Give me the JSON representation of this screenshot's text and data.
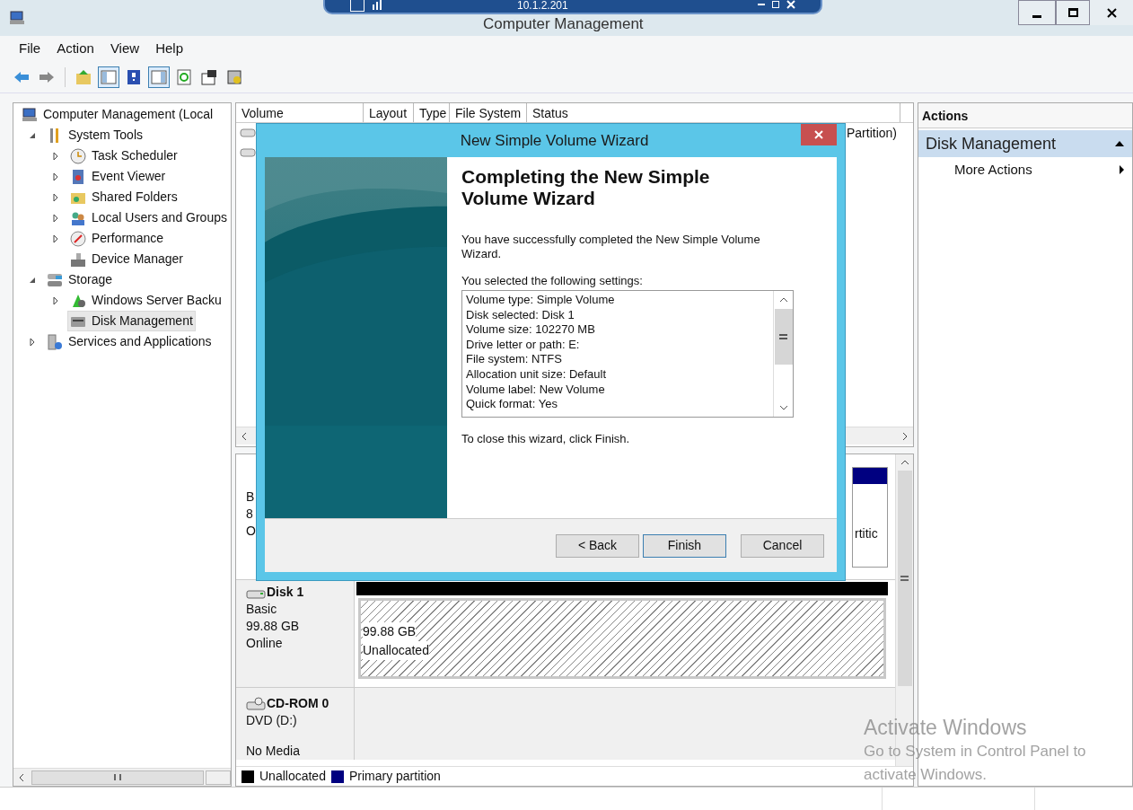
{
  "remote_bar": {
    "address": "10.1.2.201"
  },
  "window": {
    "title": "Computer Management"
  },
  "menu": [
    "File",
    "Action",
    "View",
    "Help"
  ],
  "toolbar": [
    {
      "kind": "back",
      "selected": false
    },
    {
      "kind": "forward",
      "selected": false
    },
    {
      "kind": "up",
      "selected": false
    },
    {
      "kind": "tree",
      "selected": true
    },
    {
      "kind": "help",
      "selected": false
    },
    {
      "kind": "actionpane",
      "selected": true
    },
    {
      "kind": "refresh",
      "selected": false
    },
    {
      "kind": "properties",
      "selected": false
    },
    {
      "kind": "export",
      "selected": false
    }
  ],
  "tree": [
    {
      "label": "Computer Management (Local",
      "kind": "computer",
      "selected": false,
      "children": [
        {
          "label": "System Tools",
          "kind": "tools",
          "expanded": true,
          "selected": false,
          "children": [
            {
              "label": "Task Scheduler",
              "kind": "clock",
              "expanded": false,
              "selected": false
            },
            {
              "label": "Event Viewer",
              "kind": "log",
              "expanded": false,
              "selected": false
            },
            {
              "label": "Shared Folders",
              "kind": "folder",
              "expanded": false,
              "selected": false
            },
            {
              "label": "Local Users and Groups",
              "kind": "users",
              "expanded": false,
              "selected": false
            },
            {
              "label": "Performance",
              "kind": "gauge",
              "expanded": false,
              "selected": false
            },
            {
              "label": "Device Manager",
              "kind": "device",
              "selected": false
            }
          ]
        },
        {
          "label": "Storage",
          "kind": "storage",
          "expanded": true,
          "selected": false,
          "children": [
            {
              "label": "Windows Server Backu",
              "kind": "backup",
              "expanded": false,
              "selected": false
            },
            {
              "label": "Disk Management",
              "kind": "disk",
              "selected": true
            }
          ]
        },
        {
          "label": "Services and Applications",
          "kind": "services",
          "expanded": false,
          "selected": false
        }
      ]
    }
  ],
  "volume_list": {
    "columns": [
      "Volume",
      "Layout",
      "Type",
      "File System",
      "Status"
    ],
    "rows": [
      {
        "kind": "with_status",
        "status": "Partition)"
      },
      {
        "kind": "icon_only"
      }
    ]
  },
  "disks": [
    {
      "kind": "partial",
      "label_fragments": [
        "B",
        "8",
        "O"
      ],
      "color": "#000080",
      "partition_fragment": "rtitic"
    },
    {
      "kind": "disk",
      "name": "Disk 1",
      "lines": [
        "Basic",
        "99.88 GB",
        "Online"
      ],
      "color": "#000000",
      "partition": {
        "size": "99.88 GB",
        "status": "Unallocated"
      }
    },
    {
      "kind": "cdrom",
      "name": "CD-ROM 0",
      "lines": [
        "DVD (D:)",
        "No Media"
      ]
    }
  ],
  "legend": [
    {
      "label": "Unallocated",
      "color": "#000000"
    },
    {
      "label": "Primary partition",
      "color": "#000080"
    }
  ],
  "actions": {
    "title": "Actions",
    "sections": [
      {
        "title": "Disk Management",
        "expanded": true,
        "items": [
          {
            "label": "More Actions"
          }
        ]
      }
    ]
  },
  "wizard": {
    "title": "New Simple Volume Wizard",
    "heading": "Completing the New Simple Volume Wizard",
    "intro": "You have successfully completed the New Simple Volume Wizard.",
    "settings_label": "You selected the following settings:",
    "settings": [
      "Volume type: Simple Volume",
      "Disk selected: Disk 1",
      "Volume size: 102270 MB",
      "Drive letter or path: E:",
      "File system: NTFS",
      "Allocation unit size: Default",
      "Volume label: New Volume",
      "Quick format: Yes"
    ],
    "closing": "To close this wizard, click Finish.",
    "buttons": [
      {
        "label": "< Back",
        "default": false
      },
      {
        "label": "Finish",
        "default": true
      },
      {
        "label": "Cancel",
        "default": false
      }
    ]
  },
  "activation": {
    "title": "Activate Windows",
    "text": "Go to System in Control Panel to activate Windows."
  }
}
